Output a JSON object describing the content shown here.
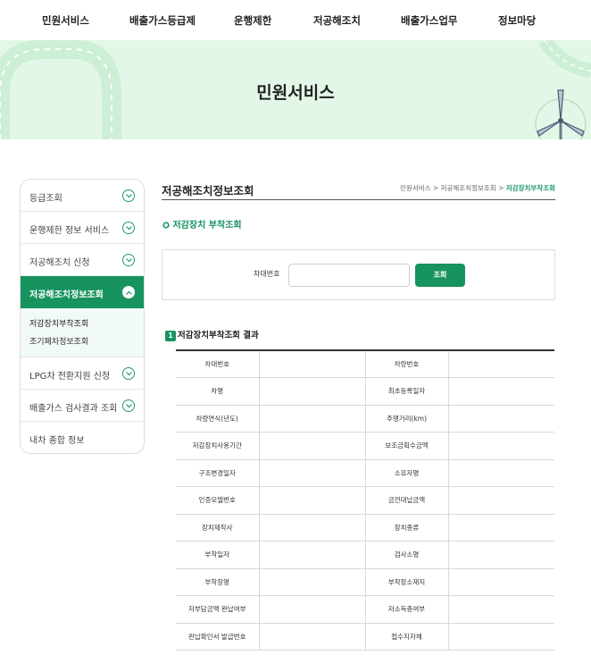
{
  "topnav": {
    "items": [
      "민원서비스",
      "배출가스등급제",
      "운행제한",
      "저공해조치",
      "배출가스업무",
      "정보마당"
    ]
  },
  "hero": {
    "title": "민원서비스"
  },
  "sidebar": {
    "items": [
      {
        "label": "등급조회"
      },
      {
        "label": "운행제한 정보 서비스"
      },
      {
        "label": "저공해조치 신청"
      },
      {
        "label": "저공해조치정보조회"
      },
      {
        "label": "LPG차 전환지원 신청"
      },
      {
        "label": "배출가스 검사결과 조회"
      },
      {
        "label": "내차 종합 정보"
      }
    ],
    "sub_items": [
      "저감장치부착조회",
      "조기폐차정보조회"
    ]
  },
  "content": {
    "section_title": "저공해조치정보조회",
    "breadcrumb": [
      "민원서비스",
      ">",
      "저공해조치정보조회",
      ">",
      "저감장치부착조회"
    ],
    "sub_title": "저감장치 부착조회",
    "search": {
      "label": "차대번호",
      "input_value": "",
      "button_label": "조회"
    },
    "result_title": "저감장치부착조회 결과",
    "result_num": "1",
    "table_rows": [
      [
        "차대번호",
        "",
        "차량번호",
        ""
      ],
      [
        "차명",
        "",
        "최초등록일자",
        ""
      ],
      [
        "차량연식(년도)",
        "",
        "주행거리(km)",
        ""
      ],
      [
        "저감장치사용기간",
        "",
        "보조금획수금액",
        ""
      ],
      [
        "구조변경일자",
        "",
        "소유자명",
        ""
      ],
      [
        "인증모델번호",
        "",
        "금전대납금액",
        ""
      ],
      [
        "장치제작사",
        "",
        "장치종류",
        ""
      ],
      [
        "부착일자",
        "",
        "검사소명",
        ""
      ],
      [
        "부착장명",
        "",
        "부착장소재지",
        ""
      ],
      [
        "자부담금액 완납여부",
        "",
        "저소득층여부",
        ""
      ],
      [
        "완납확인서 발급번호",
        "",
        "접수지자체",
        ""
      ]
    ]
  },
  "colors": {
    "accent": "#17935f",
    "hero_bg": "#e3f7e8"
  },
  "icons": [
    "chevron-down-icon",
    "wind-turbine-icon",
    "number-badge-icon"
  ]
}
